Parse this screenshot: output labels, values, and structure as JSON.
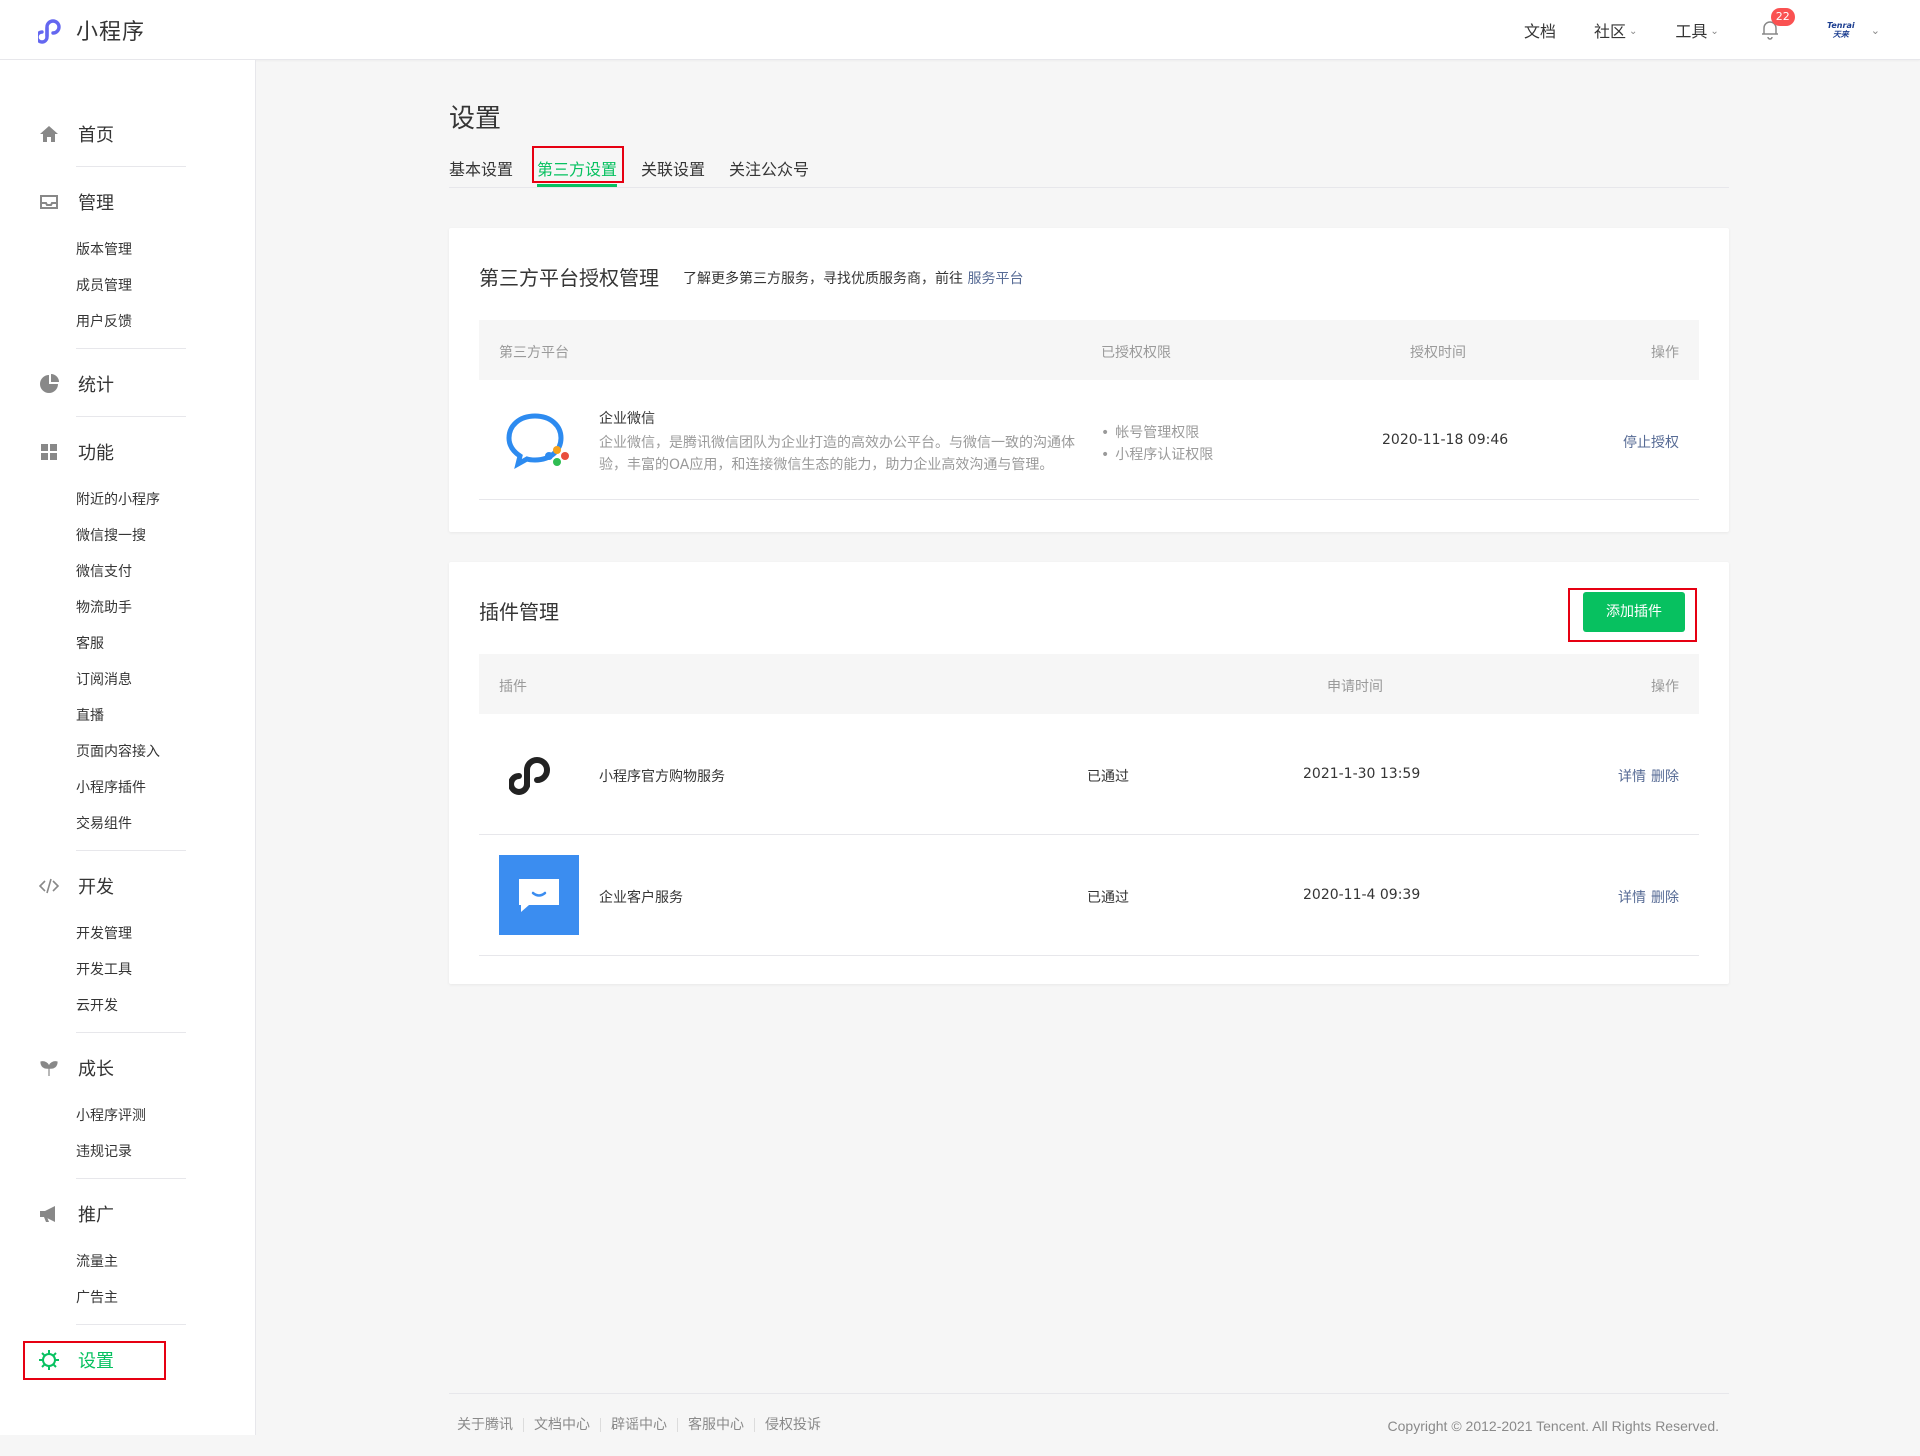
{
  "header": {
    "logo_text": "小程序",
    "nav": [
      {
        "label": "文档"
      },
      {
        "label": "社区"
      },
      {
        "label": "工具"
      }
    ],
    "notification_count": "22",
    "avatar_line1": "Tenrai",
    "avatar_line2": "天来"
  },
  "sidebar": {
    "home": "首页",
    "manage": "管理",
    "manage_items": [
      "版本管理",
      "成员管理",
      "用户反馈"
    ],
    "stats": "统计",
    "features": "功能",
    "feature_items": [
      "附近的小程序",
      "微信搜一搜",
      "微信支付",
      "物流助手",
      "客服",
      "订阅消息",
      "直播",
      "页面内容接入",
      "小程序插件",
      "交易组件"
    ],
    "dev": "开发",
    "dev_items": [
      "开发管理",
      "开发工具",
      "云开发"
    ],
    "growth": "成长",
    "growth_items": [
      "小程序评测",
      "违规记录"
    ],
    "promo": "推广",
    "promo_items": [
      "流量主",
      "广告主"
    ],
    "settings": "设置",
    "accent_color": "#07c160"
  },
  "page": {
    "title": "设置",
    "tabs": [
      "基本设置",
      "第三方设置",
      "关联设置",
      "关注公众号"
    ],
    "active_tab": "第三方设置"
  },
  "third_party": {
    "title": "第三方平台授权管理",
    "desc_prefix": "了解更多第三方服务，寻找优质服务商，前往 ",
    "desc_link": "服务平台",
    "columns": [
      "第三方平台",
      "已授权权限",
      "授权时间",
      "操作"
    ],
    "rows": [
      {
        "name": "企业微信",
        "description_line1": "企业微信，是腾讯微信团队为企业打造的高效办公平台。与微信一致的沟通体",
        "description_line2": "验，丰富的OA应用，和连接微信生态的能力，助力企业高效沟通与管理。",
        "permissions": [
          "帐号管理权限",
          "小程序认证权限"
        ],
        "time": "2020-11-18 09:46",
        "action": "停止授权"
      }
    ]
  },
  "plugins": {
    "title": "插件管理",
    "add_button": "添加插件",
    "columns": [
      "插件",
      "申请时间",
      "操作"
    ],
    "rows": [
      {
        "name": "小程序官方购物服务",
        "status": "已通过",
        "time": "2021-1-30 13:59",
        "detail": "详情",
        "delete": "删除"
      },
      {
        "name": "企业客户服务",
        "status": "已通过",
        "time": "2020-11-4 09:39",
        "detail": "详情",
        "delete": "删除"
      }
    ]
  },
  "footer": {
    "links": [
      "关于腾讯",
      "文档中心",
      "辟谣中心",
      "客服中心",
      "侵权投诉"
    ],
    "copyright": "Copyright © 2012-2021 Tencent. All Rights Reserved."
  }
}
